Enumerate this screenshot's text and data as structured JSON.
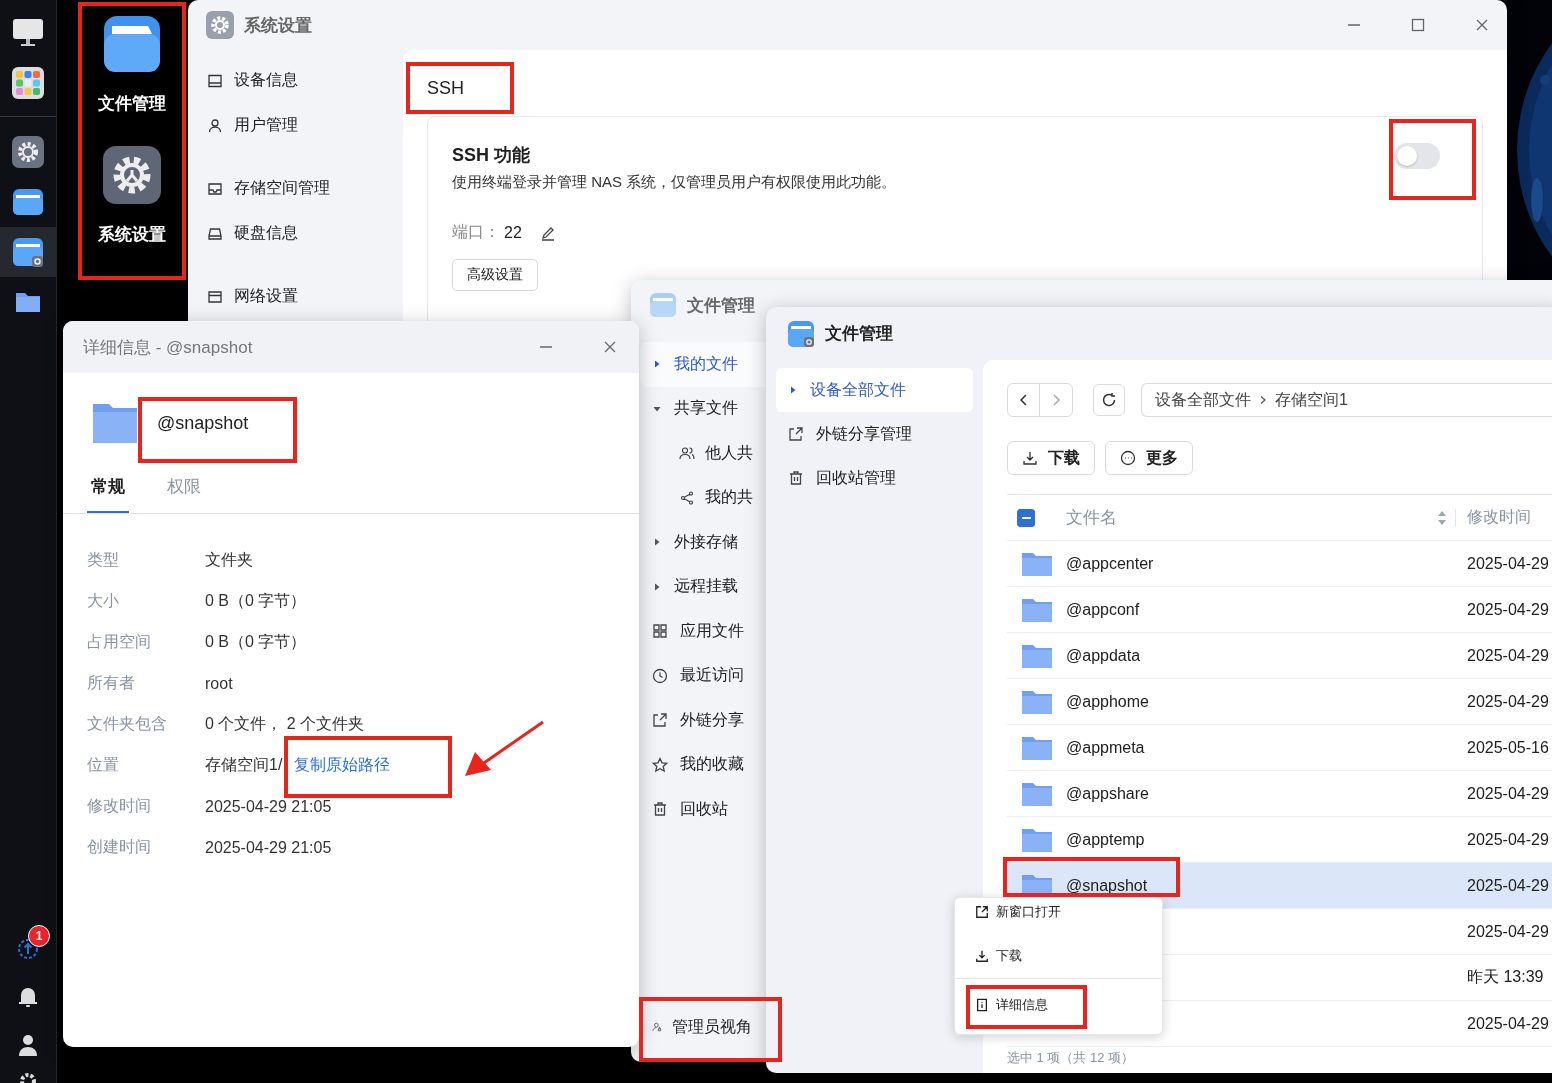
{
  "dock": {
    "items": [
      {
        "selected": false
      },
      {
        "selected": false
      },
      {
        "selected": false
      },
      {
        "selected": false
      },
      {
        "selected": true
      },
      {
        "selected": false
      }
    ],
    "upload_badge": "1"
  },
  "desktop": {
    "icons": [
      {
        "kind": "folder",
        "label": "文件管理"
      },
      {
        "kind": "settings",
        "label": "系统设置"
      }
    ]
  },
  "settings_window": {
    "title": "系统设置",
    "sidebar": [
      [
        "设备信息",
        "用户管理"
      ],
      [
        "存储空间管理",
        "硬盘信息"
      ],
      [
        "网络设置"
      ]
    ],
    "section_title": "SSH",
    "card": {
      "title": "SSH 功能",
      "description": "使用终端登录并管理 NAS 系统，仅管理员用户有权限使用此功能。",
      "enabled": false,
      "port_label": "端口：",
      "port": "22",
      "advanced_button": "高级设置"
    }
  },
  "details_window": {
    "title": "详细信息 - @snapshot",
    "name": "@snapshot",
    "tabs": [
      {
        "label": "常规",
        "selected": true
      },
      {
        "label": "权限",
        "selected": false
      }
    ],
    "properties": [
      {
        "label": "类型",
        "value": "文件夹"
      },
      {
        "label": "大小",
        "value": "0 B（0 字节）"
      },
      {
        "label": "占用空间",
        "value": "0 B（0 字节）"
      },
      {
        "label": "所有者",
        "value": "root"
      },
      {
        "label": "文件夹包含",
        "value": "0 个文件， 2 个文件夹"
      },
      {
        "label": "位置",
        "value": "存储空间1/",
        "link": "复制原始路径"
      },
      {
        "label": "修改时间",
        "value": "2025-04-29 21:05"
      },
      {
        "label": "创建时间",
        "value": "2025-04-29 21:05"
      }
    ]
  },
  "file_manager_back": {
    "title": "文件管理",
    "sidebar": [
      {
        "kind": "expander",
        "label": "我的文件",
        "expanded": false,
        "selected": true
      },
      {
        "kind": "expander",
        "label": "共享文件",
        "expanded": true,
        "selected": false,
        "children": [
          {
            "label": "他人共"
          },
          {
            "label": "我的共"
          }
        ]
      },
      {
        "kind": "expander",
        "label": "外接存储",
        "expanded": false,
        "selected": false
      },
      {
        "kind": "expander",
        "label": "远程挂载",
        "expanded": false,
        "selected": false
      },
      {
        "kind": "link",
        "label": "应用文件",
        "selected": false
      },
      {
        "kind": "link",
        "label": "最近访问",
        "selected": false
      },
      {
        "kind": "link",
        "label": "外链分享",
        "selected": false
      },
      {
        "kind": "link",
        "label": "我的收藏",
        "selected": false
      },
      {
        "kind": "link",
        "label": "回收站",
        "selected": false
      }
    ],
    "admin_view": "管理员视角"
  },
  "file_manager": {
    "title": "文件管理",
    "sidebar": [
      {
        "label": "设备全部文件",
        "selected": true
      },
      {
        "label": "外链分享管理",
        "selected": false
      },
      {
        "label": "回收站管理",
        "selected": false
      }
    ],
    "breadcrumb": [
      "设备全部文件",
      "存储空间1"
    ],
    "toolbar": [
      "下载",
      "更多"
    ],
    "select_all": {
      "indeterminate": true
    },
    "columns": [
      "文件名",
      "修改时间"
    ],
    "rows": [
      {
        "name": "@appcenter",
        "modified": "2025-04-29",
        "selected": false
      },
      {
        "name": "@appconf",
        "modified": "2025-04-29",
        "selected": false
      },
      {
        "name": "@appdata",
        "modified": "2025-04-29",
        "selected": false
      },
      {
        "name": "@apphome",
        "modified": "2025-04-29",
        "selected": false
      },
      {
        "name": "@appmeta",
        "modified": "2025-05-16",
        "selected": false
      },
      {
        "name": "@appshare",
        "modified": "2025-04-29",
        "selected": false
      },
      {
        "name": "@apptemp",
        "modified": "2025-04-29",
        "selected": false
      },
      {
        "name": "@snapshot",
        "modified": "2025-04-29",
        "selected": true
      },
      {
        "modified": "2025-04-29",
        "selected": false
      },
      {
        "modified": "昨天 13:39",
        "selected": false
      },
      {
        "modified": "2025-04-29",
        "selected": false
      }
    ],
    "status": "选中 1 项（共 12 项）"
  },
  "context_menu": [
    {
      "label": "新窗口打开",
      "separator_before": false
    },
    {
      "label": "下载",
      "separator_before": false
    },
    {
      "label": "详细信息",
      "separator_before": true
    }
  ]
}
